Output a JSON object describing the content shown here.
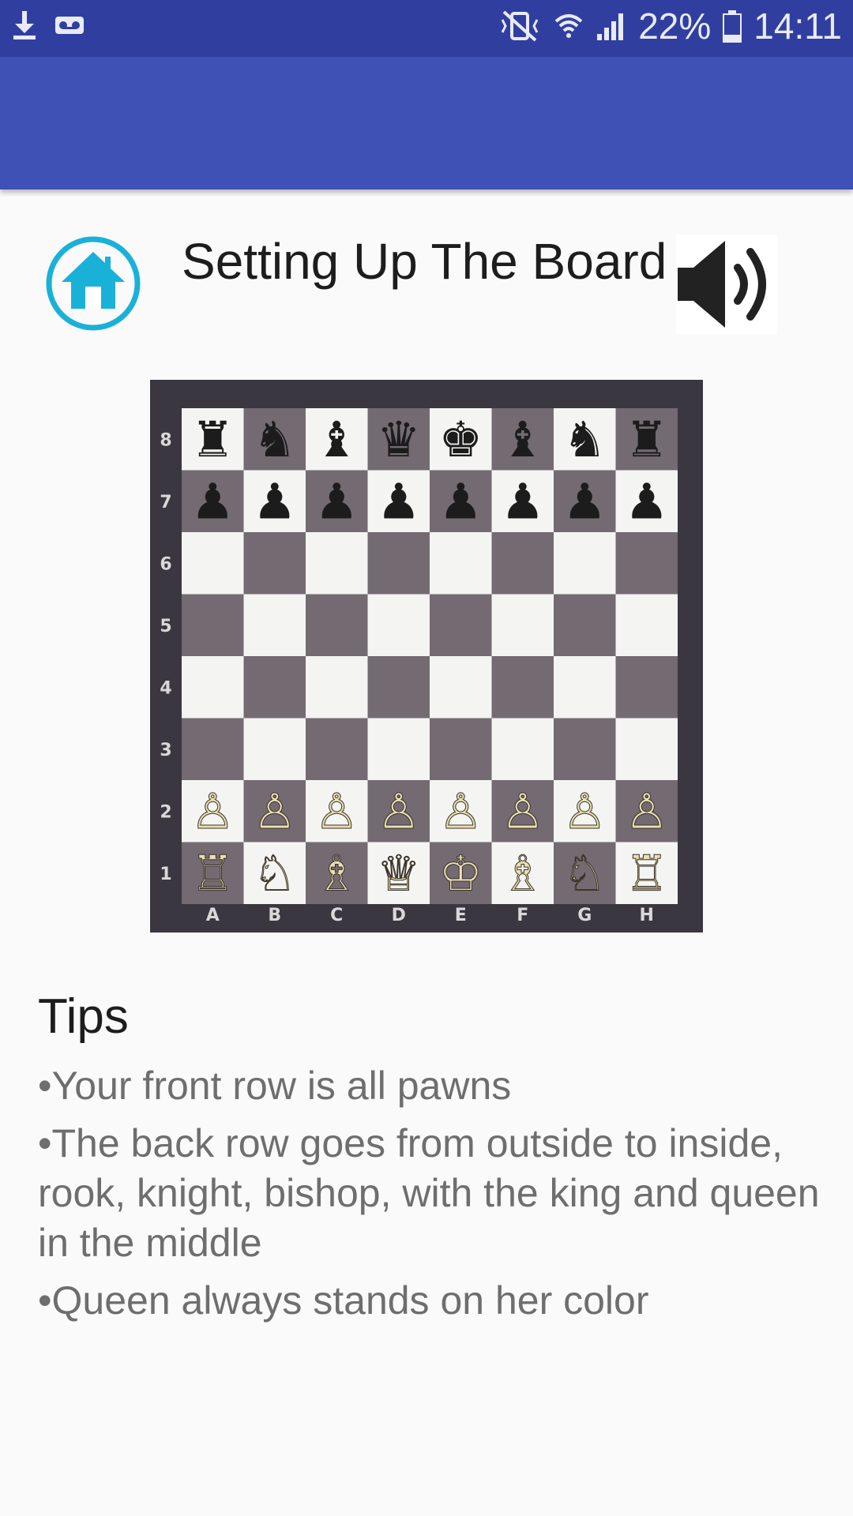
{
  "status_bar": {
    "left_icons": [
      "download-icon",
      "voicemail-icon"
    ],
    "right_icons": [
      "mute-vibrate-icon",
      "wifi-icon",
      "signal-icon",
      "battery-icon"
    ],
    "battery": "22%",
    "time": "14:11",
    "bar_color": "#303f9f"
  },
  "toolbar": {
    "color": "#3f51b5"
  },
  "header": {
    "home_icon": "home-icon",
    "title": "Setting Up The Board",
    "sound_icon": "speaker-volume-icon",
    "accent_color": "#1ab1d8"
  },
  "board": {
    "files": [
      "A",
      "B",
      "C",
      "D",
      "E",
      "F",
      "G",
      "H"
    ],
    "ranks": [
      "8",
      "7",
      "6",
      "5",
      "4",
      "3",
      "2",
      "1"
    ],
    "light_square": "#f4f4f2",
    "dark_square": "#736a72",
    "position": [
      [
        "♜",
        "♞",
        "♝",
        "♛",
        "♚",
        "♝",
        "♞",
        "♜"
      ],
      [
        "♟",
        "♟",
        "♟",
        "♟",
        "♟",
        "♟",
        "♟",
        "♟"
      ],
      [
        "",
        "",
        "",
        "",
        "",
        "",
        "",
        ""
      ],
      [
        "",
        "",
        "",
        "",
        "",
        "",
        "",
        ""
      ],
      [
        "",
        "",
        "",
        "",
        "",
        "",
        "",
        ""
      ],
      [
        "",
        "",
        "",
        "",
        "",
        "",
        "",
        ""
      ],
      [
        "♙",
        "♙",
        "♙",
        "♙",
        "♙",
        "♙",
        "♙",
        "♙"
      ],
      [
        "♖",
        "♘",
        "♗",
        "♕",
        "♔",
        "♗",
        "♘",
        "♖"
      ]
    ]
  },
  "tips": {
    "heading": "Tips",
    "items": [
      "•Your front row is all pawns",
      "•The back row goes from outside to inside, rook, knight, bishop, with the king and queen in the middle",
      "•Queen always stands on her color"
    ]
  }
}
